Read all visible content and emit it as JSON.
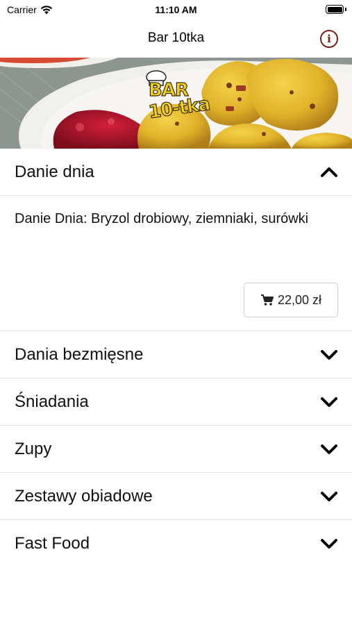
{
  "status_bar": {
    "carrier": "Carrier",
    "time": "11:10 AM",
    "wifi_icon": "wifi-icon",
    "battery_icon": "battery-icon"
  },
  "nav": {
    "title": "Bar 10tka",
    "info_icon": "info-icon",
    "accent_color": "#7a1e16"
  },
  "banner": {
    "logo_line1": "BAR",
    "logo_line2": "10-tka"
  },
  "menu": {
    "expanded": {
      "label": "Danie dnia",
      "icon": "chevron-up-icon",
      "items": [
        {
          "description": "Danie Dnia: Bryzol drobiowy, ziemniaki, surówki",
          "price": "22,00 zł",
          "icon": "cart-icon"
        }
      ]
    },
    "categories": [
      {
        "label": "Dania bezmięsne",
        "icon": "chevron-down-icon"
      },
      {
        "label": "Śniadania",
        "icon": "chevron-down-icon"
      },
      {
        "label": "Zupy",
        "icon": "chevron-down-icon"
      },
      {
        "label": "Zestawy obiadowe",
        "icon": "chevron-down-icon"
      },
      {
        "label": "Fast Food",
        "icon": "chevron-down-icon"
      }
    ]
  }
}
